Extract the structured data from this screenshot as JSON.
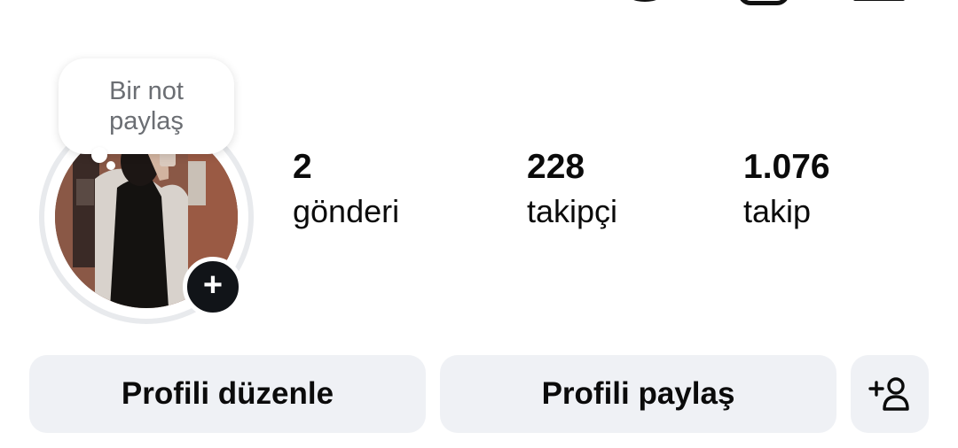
{
  "note": {
    "text": "Bir not paylaş"
  },
  "stats": [
    {
      "value": "2",
      "label": "gönderi"
    },
    {
      "value": "228",
      "label": "takipçi"
    },
    {
      "value": "1.076",
      "label": "takip"
    }
  ],
  "buttons": {
    "edit_profile": "Profili düzenle",
    "share_profile": "Profili paylaş",
    "add_user_icon": "add-person-icon"
  },
  "colors": {
    "button_bg": "#eff1f5",
    "ring": "#e8eaed",
    "note_text": "#6b6e73",
    "dark": "#111418"
  }
}
